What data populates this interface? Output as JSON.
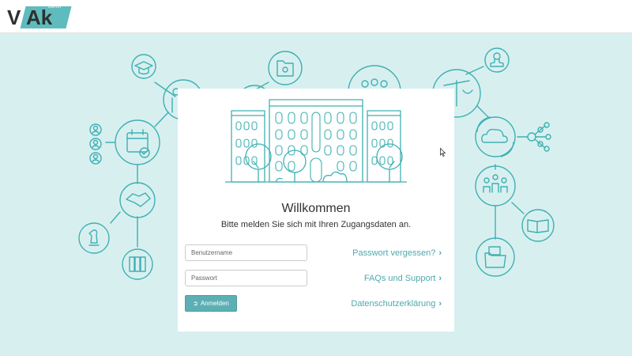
{
  "header": {
    "logo_main": "V",
    "logo_ak": "Ak",
    "logo_small": "Berlin"
  },
  "login": {
    "title": "Willkommen",
    "subtitle": "Bitte melden Sie sich mit Ihren Zugangsdaten an.",
    "username_placeholder": "Benutzername",
    "password_placeholder": "Passwort",
    "login_button": "Anmelden",
    "login_icon": "sign-in-icon"
  },
  "links": {
    "forgot_password": "Passwort vergessen?",
    "faq": "FAQs und Support",
    "privacy": "Datenschutzerklärung"
  },
  "colors": {
    "accent": "#4fa9ad",
    "background": "#d8eff0",
    "button": "#5cb0b3"
  }
}
